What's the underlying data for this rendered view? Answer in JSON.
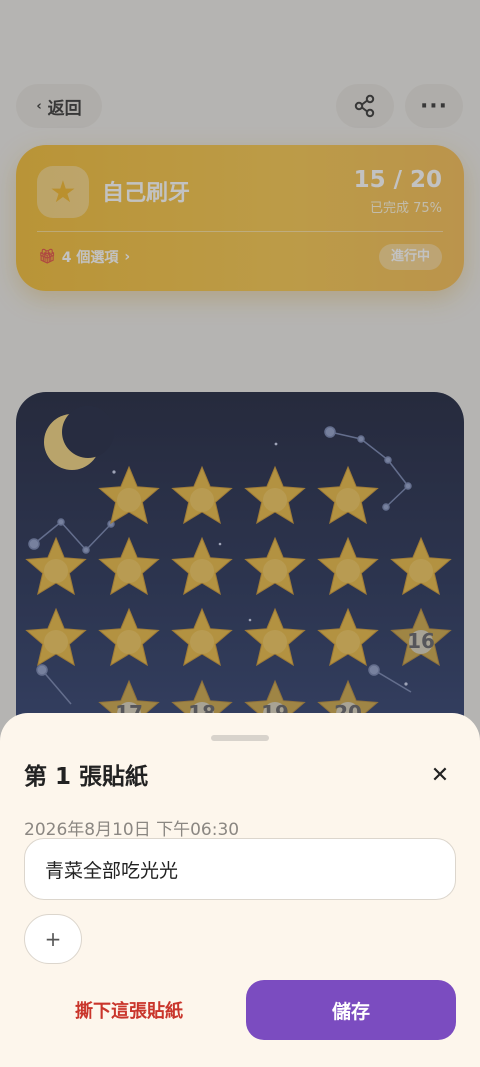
{
  "header": {
    "back_label": "返回",
    "back_icon": "chevron-left-icon",
    "share_icon": "share-icon",
    "more_label": "···"
  },
  "card": {
    "icon": "star-icon",
    "title": "自己刷牙",
    "count": "15 / 20",
    "subtitle": "已完成 75%",
    "options_label": "4 個選項",
    "status": "進行中",
    "accent": "#f2b92a"
  },
  "board": {
    "filled": 15,
    "total": 20,
    "empty_numbers": [
      "16",
      "17",
      "18",
      "19",
      "20"
    ],
    "colors": {
      "sky_top": "#101733",
      "sky_bottom": "#2a3f78",
      "star": "#e8b63a",
      "moon": "#f2d27a"
    }
  },
  "sheet": {
    "title": "第 1 張貼紙",
    "close_label": "✕",
    "date": "2026年8月10日 下午06:30",
    "note_value": "青菜全部吃光光",
    "add_label": "+",
    "remove_label": "撕下這張貼紙",
    "save_label": "儲存",
    "colors": {
      "save": "#7b4cc0",
      "remove": "#c9352b"
    }
  }
}
